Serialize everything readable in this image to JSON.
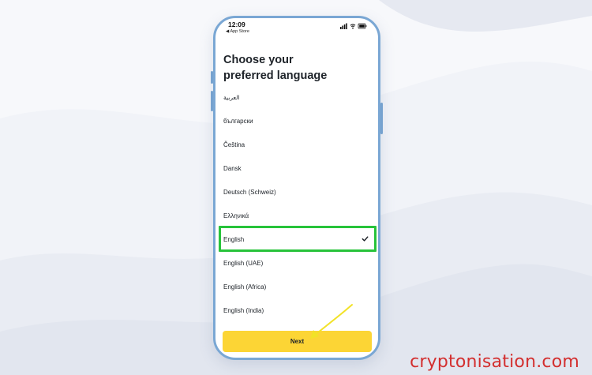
{
  "status_bar": {
    "time": "12:09",
    "back_label": "◀ App Store",
    "icons": [
      "signal-icon",
      "wifi-icon",
      "battery-icon"
    ]
  },
  "screen": {
    "title_line1": "Choose your",
    "title_line2": "preferred language",
    "languages": [
      {
        "label": "العربية",
        "selected": false
      },
      {
        "label": "български",
        "selected": false
      },
      {
        "label": "Čeština",
        "selected": false
      },
      {
        "label": "Dansk",
        "selected": false
      },
      {
        "label": "Deutsch (Schweiz)",
        "selected": false
      },
      {
        "label": "Ελληνικά",
        "selected": false
      },
      {
        "label": "English",
        "selected": true
      },
      {
        "label": "English (UAE)",
        "selected": false
      },
      {
        "label": "English (Africa)",
        "selected": false
      },
      {
        "label": "English (India)",
        "selected": false
      }
    ],
    "next_label": "Next"
  },
  "colors": {
    "accent_button": "#fcd535",
    "highlight_border": "#27c33a",
    "phone_border": "#7aa7d4",
    "arrow": "#f2e227",
    "watermark": "#d32f2f"
  },
  "watermark": "cryptonisation.com"
}
